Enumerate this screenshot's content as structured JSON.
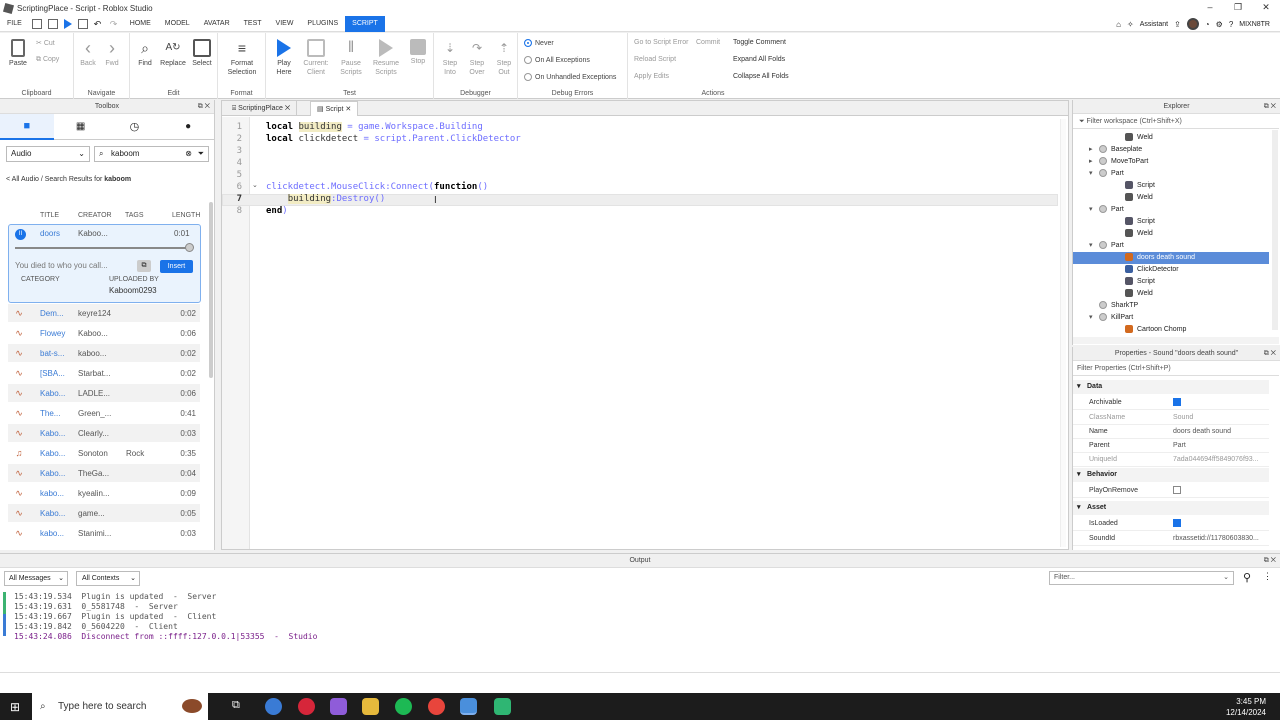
{
  "window": {
    "title": "ScriptingPlace - Script - Roblox Studio"
  },
  "menubar": {
    "file": "FILE",
    "tabs": [
      "HOME",
      "MODEL",
      "AVATAR",
      "TEST",
      "VIEW",
      "PLUGINS",
      "SCRIPT"
    ],
    "active_tab": "SCRIPT",
    "assistant": "Assistant",
    "username": "MIXN8TR"
  },
  "ribbon": {
    "clipboard": {
      "paste": "Paste",
      "cut": "Cut",
      "copy": "Copy",
      "label": "Clipboard"
    },
    "navigate": {
      "back": "Back",
      "fwd": "Fwd",
      "label": "Navigate"
    },
    "edit": {
      "find": "Find",
      "replace": "Replace",
      "select": "Select",
      "label": "Edit"
    },
    "format": {
      "format_selection": "Format Selection",
      "label": "Format"
    },
    "test": {
      "play_here": "Play Here",
      "current_client": "Current: Client",
      "pause_scripts": "Pause Scripts",
      "resume_scripts": "Resume Scripts",
      "stop": "Stop",
      "label": "Test"
    },
    "debugger": {
      "step_into": "Step Into",
      "step_over": "Step Over",
      "step_out": "Step Out",
      "label": "Debugger"
    },
    "debug_errors": {
      "never": "Never",
      "on_all": "On All Exceptions",
      "on_unhandled": "On Unhandled Exceptions",
      "label": "Debug Errors"
    },
    "actions": {
      "go_to_error": "Go to Script Error",
      "commit": "Commit",
      "toggle_comment": "Toggle Comment",
      "reload_script": "Reload Script",
      "expand_all": "Expand All Folds",
      "apply_edits": "Apply Edits",
      "collapse_all": "Collapse All Folds",
      "label": "Actions"
    }
  },
  "toolbox": {
    "title": "Toolbox",
    "category": "Audio",
    "search_value": "kaboom",
    "breadcrumb_prefix": "< All Audio / Search Results for ",
    "breadcrumb_term": "kaboom",
    "columns": {
      "title": "TITLE",
      "creator": "CREATOR",
      "tags": "TAGS",
      "length": "LENGTH"
    },
    "selected": {
      "title": "doors",
      "creator": "Kaboo...",
      "length": "0:01",
      "progress_fraction": 0.98,
      "description": "You died to who you call...",
      "insert": "Insert",
      "category_label": "CATEGORY",
      "uploaded_label": "UPLOADED BY",
      "uploader": "Kaboom0293"
    },
    "rows": [
      {
        "title": "Dem...",
        "creator": "keyre124",
        "tags": "",
        "length": "0:02",
        "icon": "wave"
      },
      {
        "title": "Flowey",
        "creator": "Kaboo...",
        "tags": "",
        "length": "0:06",
        "icon": "wave"
      },
      {
        "title": "bat-s...",
        "creator": "kaboo...",
        "tags": "",
        "length": "0:02",
        "icon": "wave"
      },
      {
        "title": "[SBA...",
        "creator": "Starbat...",
        "tags": "",
        "length": "0:02",
        "icon": "wave"
      },
      {
        "title": "Kabo...",
        "creator": "LADLE...",
        "tags": "",
        "length": "0:06",
        "icon": "wave"
      },
      {
        "title": "The...",
        "creator": "Green_...",
        "tags": "",
        "length": "0:41",
        "icon": "wave"
      },
      {
        "title": "Kabo...",
        "creator": "Clearly...",
        "tags": "",
        "length": "0:03",
        "icon": "wave"
      },
      {
        "title": "Kabo...",
        "creator": "Sonoton",
        "tags": "Rock",
        "length": "0:35",
        "icon": "note"
      },
      {
        "title": "Kabo...",
        "creator": "TheGa...",
        "tags": "",
        "length": "0:04",
        "icon": "wave"
      },
      {
        "title": "kabo...",
        "creator": "kyealin...",
        "tags": "",
        "length": "0:09",
        "icon": "wave"
      },
      {
        "title": "Kabo...",
        "creator": "game...",
        "tags": "",
        "length": "0:05",
        "icon": "wave"
      },
      {
        "title": "kabo...",
        "creator": "Stanimi...",
        "tags": "",
        "length": "0:03",
        "icon": "wave"
      }
    ]
  },
  "editor": {
    "tabs": [
      "ScriptingPlace",
      "Script"
    ],
    "active_tab": "Script",
    "lines": [
      {
        "n": "1",
        "a": "local ",
        "b": "building",
        "c": " = game.Workspace.Building"
      },
      {
        "n": "2",
        "a": "local ",
        "b": "clickdetect",
        "c": " = script.Parent.ClickDetector"
      },
      {
        "n": "3",
        "a": "",
        "b": "",
        "c": ""
      },
      {
        "n": "4",
        "a": "",
        "b": "",
        "c": ""
      },
      {
        "n": "5",
        "a": "",
        "b": "",
        "c": ""
      },
      {
        "n": "6",
        "a": "",
        "b": "clickdetect.MouseClick:Connect(",
        "c": "function",
        "d": "()"
      },
      {
        "n": "7",
        "a": "    ",
        "b": "building",
        "c": ":Destroy()"
      },
      {
        "n": "8",
        "a": "end",
        "b": ")",
        "c": ""
      }
    ]
  },
  "explorer": {
    "title": "Explorer",
    "filter_placeholder": "Filter workspace (Ctrl+Shift+X)",
    "items": [
      {
        "label": "Weld",
        "icon": "weld"
      },
      {
        "label": "Baseplate",
        "icon": "part"
      },
      {
        "label": "MoveToPart",
        "icon": "part"
      },
      {
        "label": "Part",
        "icon": "part"
      },
      {
        "label": "Script",
        "icon": "script"
      },
      {
        "label": "Weld",
        "icon": "weld"
      },
      {
        "label": "Part",
        "icon": "part"
      },
      {
        "label": "Script",
        "icon": "script"
      },
      {
        "label": "Weld",
        "icon": "weld"
      },
      {
        "label": "Part",
        "icon": "part"
      },
      {
        "label": "doors death sound",
        "icon": "sound",
        "selected": true
      },
      {
        "label": "ClickDetector",
        "icon": "click"
      },
      {
        "label": "Script",
        "icon": "script"
      },
      {
        "label": "Weld",
        "icon": "weld"
      },
      {
        "label": "SharkTP",
        "icon": "part"
      },
      {
        "label": "KillPart",
        "icon": "part"
      },
      {
        "label": "Cartoon Chomp",
        "icon": "sound"
      }
    ]
  },
  "properties": {
    "title": "Properties - Sound \"doors death sound\"",
    "filter_placeholder": "Filter Properties (Ctrl+Shift+P)",
    "sections": {
      "data": "Data",
      "behavior": "Behavior",
      "asset": "Asset"
    },
    "archivable": "Archivable",
    "classname_k": "ClassName",
    "classname_v": "Sound",
    "name_k": "Name",
    "name_v": "doors death sound",
    "parent_k": "Parent",
    "parent_v": "Part",
    "uniqueid_k": "UniqueId",
    "uniqueid_v": "7ada044694ff5849076f93...",
    "playonremove": "PlayOnRemove",
    "isloaded": "IsLoaded",
    "soundid_k": "SoundId",
    "soundid_v": "rbxassetid://11780603830..."
  },
  "output": {
    "title": "Output",
    "all_messages": "All Messages",
    "all_contexts": "All Contexts",
    "filter_placeholder": "Filter...",
    "lines": [
      {
        "text": "15:43:19.534  Plugin is updated  -  Server"
      },
      {
        "text": "15:43:19.631  0_5581748  -  Server"
      },
      {
        "text": "15:43:19.667  Plugin is updated  -  Client"
      },
      {
        "text": "15:43:19.842  0_5604220  -  Client"
      },
      {
        "text": "15:43:24.086  Disconnect from ::ffff:127.0.0.1|53355  -  Studio"
      }
    ]
  },
  "taskbar": {
    "search_placeholder": "Type here to search",
    "time": "3:45 PM",
    "date": "12/14/2024"
  }
}
